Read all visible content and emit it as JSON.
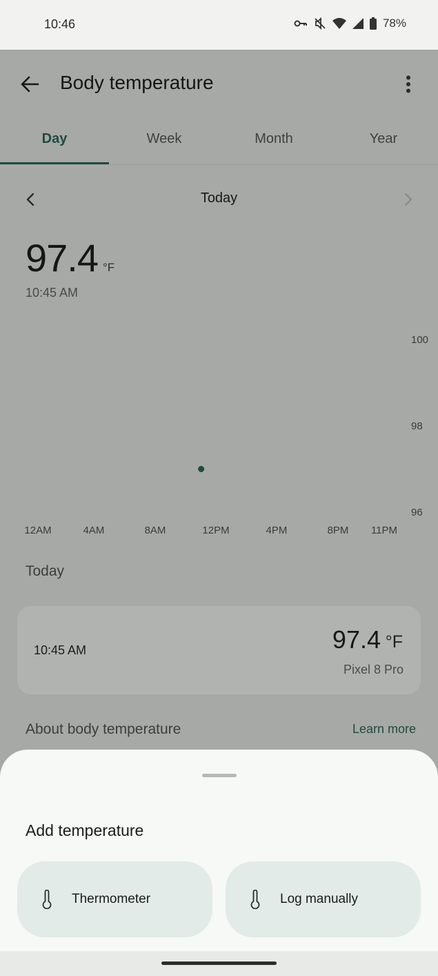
{
  "status_bar": {
    "time": "10:46",
    "battery": "78%",
    "icons": [
      "vpn-key-icon",
      "mute-icon",
      "wifi-icon",
      "signal-icon",
      "battery-icon"
    ]
  },
  "header": {
    "title": "Body temperature",
    "back_icon": "arrow-back-icon",
    "more_icon": "more-vert-icon"
  },
  "tabs": [
    {
      "label": "Day",
      "active": true
    },
    {
      "label": "Week",
      "active": false
    },
    {
      "label": "Month",
      "active": false
    },
    {
      "label": "Year",
      "active": false
    }
  ],
  "period": {
    "label": "Today"
  },
  "summary": {
    "value": "97.4",
    "unit": "°F",
    "time": "10:45 AM"
  },
  "chart_data": {
    "type": "scatter",
    "x_ticks": [
      "12AM",
      "4AM",
      "8AM",
      "12PM",
      "4PM",
      "8PM",
      "11PM"
    ],
    "y_ticks": [
      "100",
      "98",
      "96"
    ],
    "ylim": [
      96,
      100
    ],
    "xlim_hours": [
      0,
      23
    ],
    "points": [
      {
        "x_hour": 10.75,
        "y": 97.4
      }
    ],
    "point_color": "#1f4a40",
    "grid": false
  },
  "list": {
    "heading": "Today",
    "readings": [
      {
        "time": "10:45 AM",
        "value": "97.4",
        "unit": "°F",
        "source": "Pixel 8 Pro"
      }
    ]
  },
  "about": {
    "title": "About body temperature",
    "link": "Learn more"
  },
  "sheet": {
    "title": "Add temperature",
    "actions": [
      {
        "label": "Thermometer",
        "icon": "thermometer-icon"
      },
      {
        "label": "Log manually",
        "icon": "thermometer-icon"
      }
    ]
  },
  "colors": {
    "accent": "#1f4a40",
    "scrim": "#a7a9a6",
    "sheet": "#f7f9f6",
    "button": "#e2ebe8"
  }
}
